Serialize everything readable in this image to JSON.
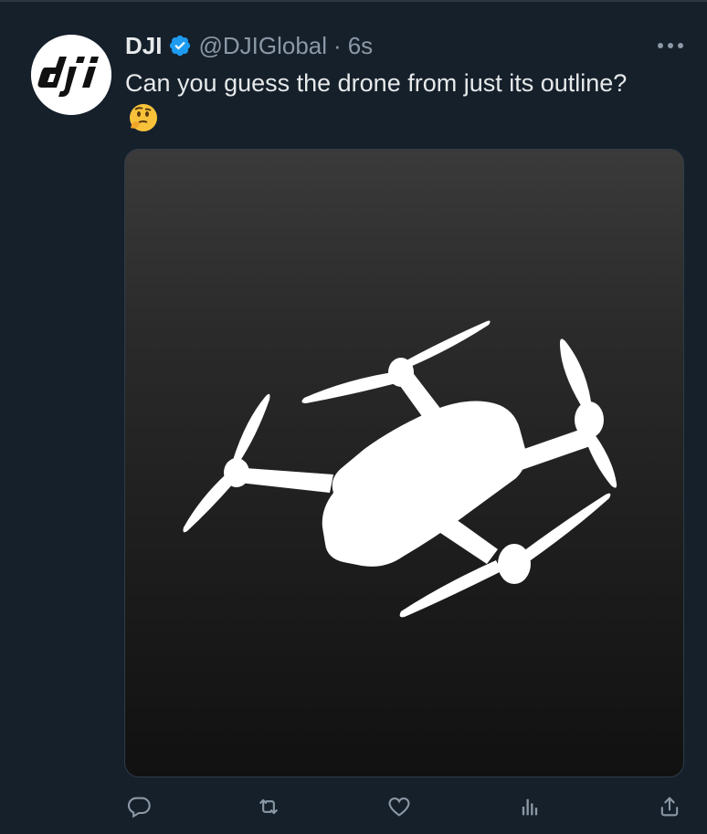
{
  "tweet": {
    "author_name": "DJI",
    "handle": "@DJIGlobal",
    "separator": "·",
    "time": "6s",
    "text": "Can you guess the drone from just its outline?",
    "emoji": "🤔",
    "avatar_logo_text": "dji",
    "verified": true
  },
  "icons": {
    "verified": "verified-badge-icon",
    "more": "more-options-icon",
    "reply": "reply-icon",
    "retweet": "retweet-icon",
    "like": "like-icon",
    "views": "views-icon",
    "share": "share-icon"
  },
  "colors": {
    "background": "#15202b",
    "text_primary": "#e7e9ea",
    "text_secondary": "#8b98a5",
    "verified_blue": "#1d9bf0",
    "media_background": "#1b1b1b",
    "silhouette": "#ffffff"
  }
}
